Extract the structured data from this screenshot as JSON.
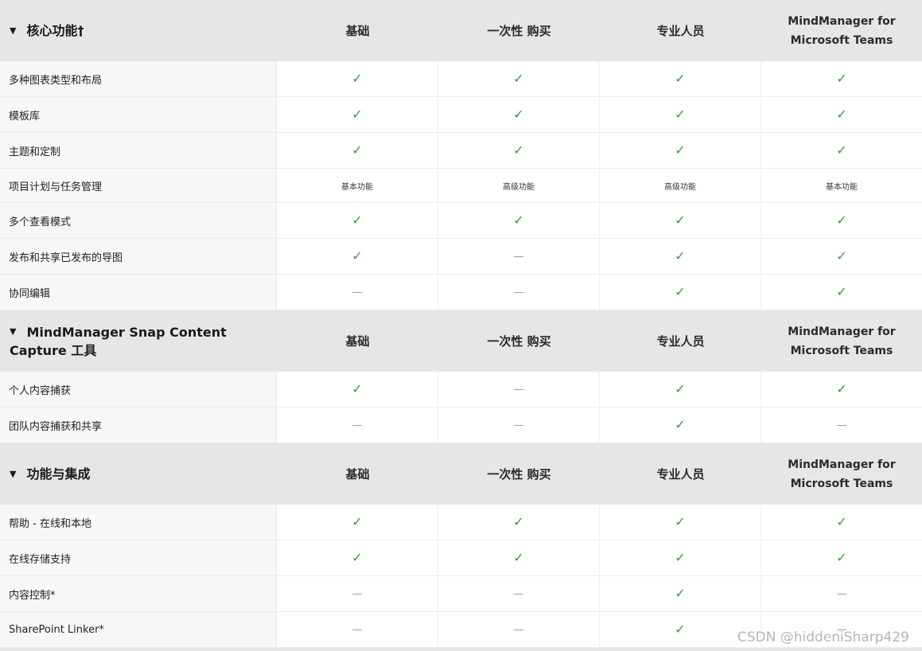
{
  "sections": [
    {
      "title": "核心功能†",
      "columns": [
        "基础",
        "一次性 购买",
        "专业人员",
        "MindManager for",
        "Microsoft Teams"
      ],
      "rows": [
        {
          "label": "多种图表类型和布局",
          "cells": [
            "✓",
            "✓",
            "✓",
            "✓"
          ]
        },
        {
          "label": "模板库",
          "cells": [
            "✓",
            "✓",
            "✓",
            "✓"
          ]
        },
        {
          "label": "主题和定制",
          "cells": [
            "✓",
            "✓",
            "✓",
            "✓"
          ]
        },
        {
          "label": "项目计划与任务管理",
          "cells": [
            "基本功能",
            "高级功能",
            "高级功能",
            "基本功能"
          ]
        },
        {
          "label": "多个查看模式",
          "cells": [
            "✓",
            "✓",
            "✓",
            "✓"
          ]
        },
        {
          "label": "发布和共享已发布的导图",
          "cells": [
            "✓",
            "—",
            "✓",
            "✓"
          ]
        },
        {
          "label": "协同编辑",
          "cells": [
            "—",
            "—",
            "✓",
            "✓"
          ]
        }
      ]
    },
    {
      "title": "MindManager Snap Content Capture 工具",
      "columns": [
        "基础",
        "一次性 购买",
        "专业人员",
        "MindManager for",
        "Microsoft Teams"
      ],
      "rows": [
        {
          "label": "个人内容捕获",
          "cells": [
            "✓",
            "—",
            "✓",
            "✓"
          ]
        },
        {
          "label": "团队内容捕获和共享",
          "cells": [
            "—",
            "—",
            "✓",
            "—"
          ]
        }
      ]
    },
    {
      "title": "功能与集成",
      "columns": [
        "基础",
        "一次性 购买",
        "专业人员",
        "MindManager for",
        "Microsoft Teams"
      ],
      "rows": [
        {
          "label": "帮助 - 在线和本地",
          "cells": [
            "✓",
            "✓",
            "✓",
            "✓"
          ]
        },
        {
          "label": "在线存储支持",
          "cells": [
            "✓",
            "✓",
            "✓",
            "✓"
          ]
        },
        {
          "label": "内容控制*",
          "cells": [
            "—",
            "—",
            "✓",
            "—"
          ]
        },
        {
          "label": "SharePoint Linker*",
          "cells": [
            "—",
            "—",
            "✓",
            "—"
          ]
        }
      ]
    }
  ],
  "icons": {
    "expand": "caret-down-icon",
    "check": "check-icon",
    "dash": "dash-icon"
  },
  "colors": {
    "check": "#3a9a3a",
    "header_bg": "#e6e6e6",
    "label_bg": "#f7f7f7"
  },
  "watermark": "CSDN @hiddeniSharp429"
}
